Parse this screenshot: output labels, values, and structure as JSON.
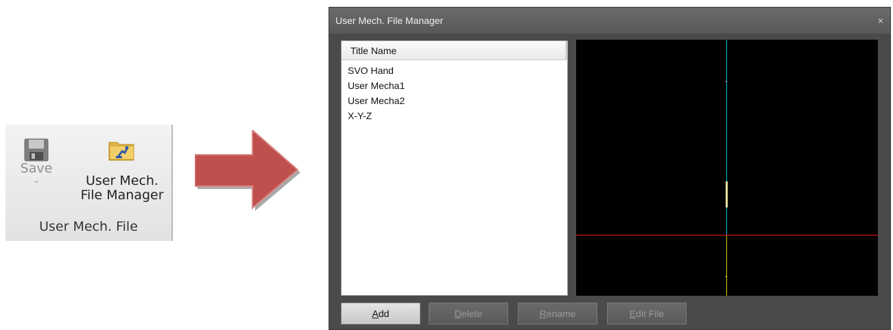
{
  "ribbon": {
    "save_label": "Save",
    "save_chevron": "⌄",
    "umfm_label_line1": "User Mech.",
    "umfm_label_line2": "File Manager",
    "group_label": "User Mech. File"
  },
  "dialog": {
    "title": "User Mech. File Manager",
    "close_glyph": "×",
    "list_header": "Title Name",
    "items": [
      "SVO Hand",
      "User Mecha1",
      "User Mecha2",
      "X-Y-Z"
    ],
    "buttons": [
      {
        "underline": "A",
        "rest": "dd",
        "enabled": true
      },
      {
        "underline": "D",
        "rest": "elete",
        "enabled": false
      },
      {
        "underline": "R",
        "rest": "ename",
        "enabled": false
      },
      {
        "underline": "E",
        "rest": "dit File",
        "enabled": false
      }
    ]
  },
  "colors": {
    "arrow": "#c0504d",
    "axis_cyan": "#00c8d8",
    "axis_red": "#d01010",
    "axis_yellow": "#e8d000",
    "viewport_bg": "#000000"
  },
  "icons": [
    "floppy-disk-icon",
    "folder-robot-icon",
    "right-arrow-icon",
    "close-icon"
  ]
}
